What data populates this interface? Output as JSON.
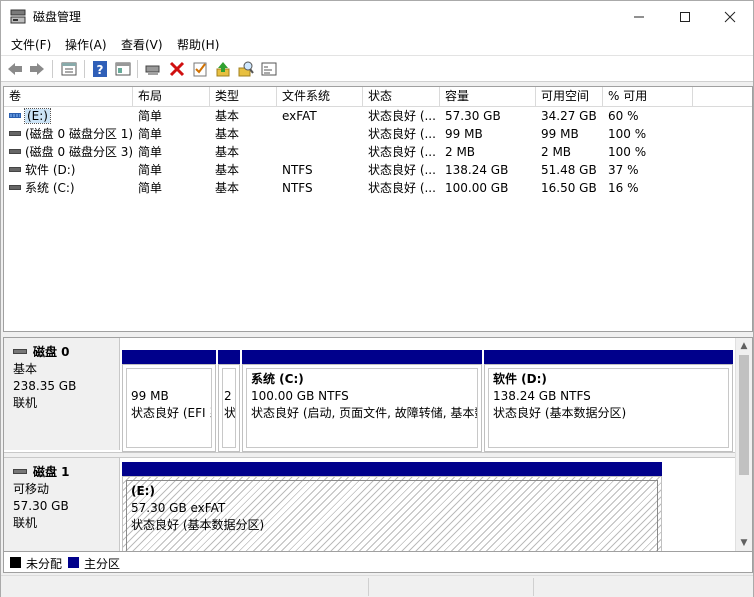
{
  "window": {
    "title": "磁盘管理"
  },
  "menu": [
    "文件(F)",
    "操作(A)",
    "查看(V)",
    "帮助(H)"
  ],
  "toolbar_icons": [
    "back-icon",
    "forward-icon",
    "properties-icon",
    "help-icon",
    "view-icon",
    "connect-icon",
    "delete-icon",
    "check-icon",
    "upload-icon",
    "search-icon",
    "console-icon"
  ],
  "columns": [
    "卷",
    "布局",
    "类型",
    "文件系统",
    "状态",
    "容量",
    "可用空间",
    "% 可用"
  ],
  "volumes": [
    {
      "name": "(E:)",
      "layout": "简单",
      "type": "基本",
      "fs": "exFAT",
      "status": "状态良好 (...",
      "capacity": "57.30 GB",
      "free": "34.27 GB",
      "pct": "60 %"
    },
    {
      "name": "(磁盘 0 磁盘分区 1)",
      "layout": "简单",
      "type": "基本",
      "fs": "",
      "status": "状态良好 (...",
      "capacity": "99 MB",
      "free": "99 MB",
      "pct": "100 %"
    },
    {
      "name": "(磁盘 0 磁盘分区 3)",
      "layout": "简单",
      "type": "基本",
      "fs": "",
      "status": "状态良好 (...",
      "capacity": "2 MB",
      "free": "2 MB",
      "pct": "100 %"
    },
    {
      "name": "软件 (D:)",
      "layout": "简单",
      "type": "基本",
      "fs": "NTFS",
      "status": "状态良好 (...",
      "capacity": "138.24 GB",
      "free": "51.48 GB",
      "pct": "37 %"
    },
    {
      "name": "系统 (C:)",
      "layout": "简单",
      "type": "基本",
      "fs": "NTFS",
      "status": "状态良好 (...",
      "capacity": "100.00 GB",
      "free": "16.50 GB",
      "pct": "16 %"
    }
  ],
  "disks": [
    {
      "name": "磁盘 0",
      "kind": "基本",
      "size": "238.35 GB",
      "state": "联机",
      "partitions": [
        {
          "title": "",
          "size": "99 MB",
          "status": "状态良好 (EFI 系"
        },
        {
          "title": "",
          "size": "2",
          "status": "状"
        },
        {
          "title": "系统 (C:)",
          "size": "100.00 GB NTFS",
          "status": "状态良好 (启动, 页面文件, 故障转储, 基本数"
        },
        {
          "title": "软件 (D:)",
          "size": "138.24 GB NTFS",
          "status": "状态良好 (基本数据分区)"
        }
      ]
    },
    {
      "name": "磁盘 1",
      "kind": "可移动",
      "size": "57.30 GB",
      "state": "联机",
      "partitions": [
        {
          "title": "(E:)",
          "size": "57.30 GB exFAT",
          "status": "状态良好 (基本数据分区)"
        }
      ]
    }
  ],
  "legend": [
    {
      "label": "未分配",
      "color": "#000000"
    },
    {
      "label": "主分区",
      "color": "#00008b"
    }
  ]
}
